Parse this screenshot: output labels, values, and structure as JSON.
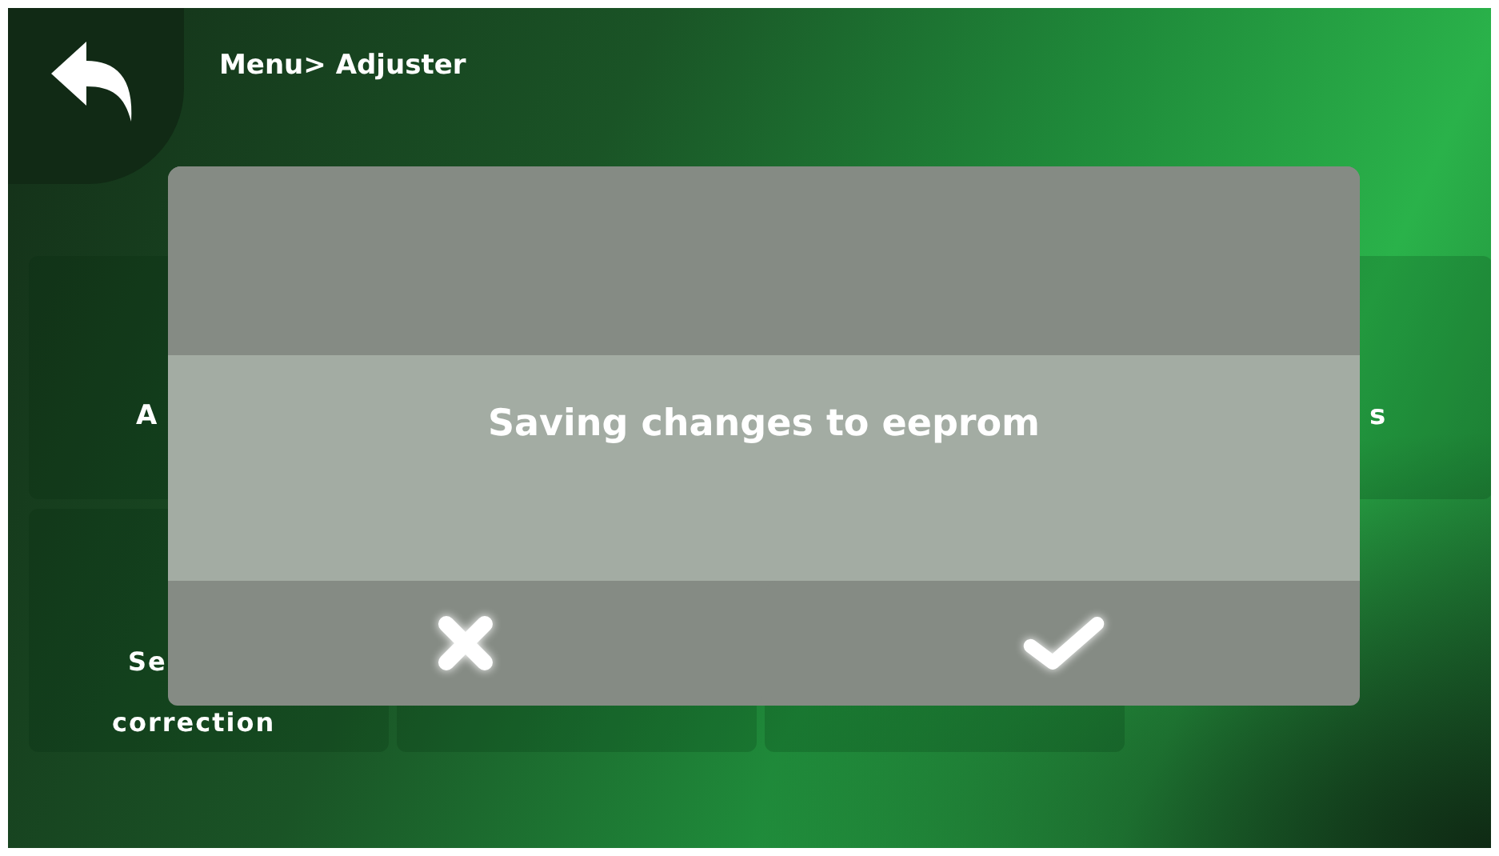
{
  "header": {
    "breadcrumb": "Menu> Adjuster"
  },
  "tile_labels": [
    {
      "lines": [
        "A"
      ]
    },
    {
      "lines": [
        "s"
      ]
    },
    {
      "lines": [
        "Se",
        "correction"
      ]
    }
  ],
  "dialog": {
    "message": "Saving changes to eeprom",
    "buttons": [
      {
        "kind": "cancel"
      },
      {
        "kind": "confirm"
      }
    ]
  }
}
